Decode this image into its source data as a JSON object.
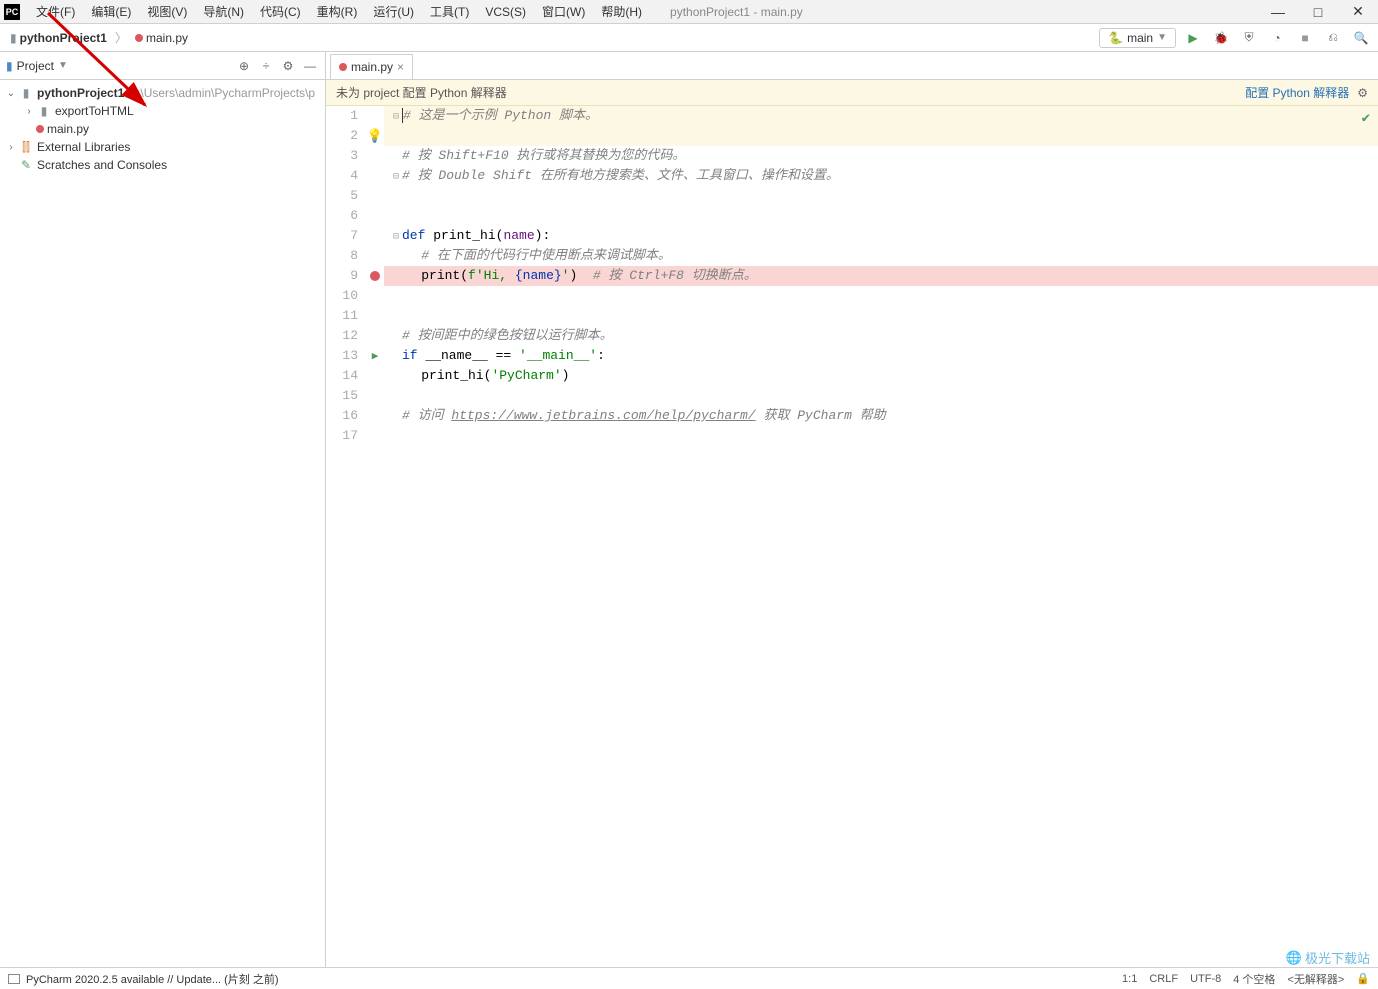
{
  "menu": {
    "items": [
      "文件(F)",
      "编辑(E)",
      "视图(V)",
      "导航(N)",
      "代码(C)",
      "重构(R)",
      "运行(U)",
      "工具(T)",
      "VCS(S)",
      "窗口(W)",
      "帮助(H)"
    ],
    "window_title": "pythonProject1 - main.py"
  },
  "breadcrumb": {
    "project": "pythonProject1",
    "file": "main.py"
  },
  "run_config": {
    "label": "main"
  },
  "sidebar": {
    "title": "Project",
    "tree": {
      "root": "pythonProject1",
      "root_path": "C:\\Users\\admin\\PycharmProjects\\p",
      "children": [
        "exportToHTML",
        "main.py"
      ],
      "external": "External Libraries",
      "scratches": "Scratches and Consoles"
    }
  },
  "tab": {
    "label": "main.py"
  },
  "warn": {
    "text": "未为 project 配置 Python 解释器",
    "link": "配置 Python 解释器"
  },
  "code": {
    "l1_cmt": "# 这是一个示例 Python 脚本。",
    "l3_cmt": "# 按 Shift+F10 执行或将其替换为您的代码。",
    "l4_cmt": "# 按 Double Shift 在所有地方搜索类、文件、工具窗口、操作和设置。",
    "l7_def": "def ",
    "l7_fn": "print_hi",
    "l7_prm": "name",
    "l8_cmt": "# 在下面的代码行中使用断点来调试脚本。",
    "l9_fn": "print",
    "l9_s1": "f'Hi, ",
    "l9_var": "{name}",
    "l9_s2": "'",
    "l9_cmt": "# 按 Ctrl+F8 切换断点。",
    "l12_cmt": "# 按间距中的绿色按钮以运行脚本。",
    "l13_if": "if ",
    "l13_name": "__name__",
    "l13_eq": " == ",
    "l13_main": "'__main__'",
    "l14_fn": "print_hi",
    "l14_arg": "'PyCharm'",
    "l16_pre": "# 访问 ",
    "l16_url": "https://www.jetbrains.com/help/pycharm/",
    "l16_post": " 获取 PyCharm 帮助"
  },
  "status": {
    "left": "PyCharm 2020.2.5 available // Update... (片刻 之前)",
    "pos": "1:1",
    "sep": "CRLF",
    "enc": "UTF-8",
    "indent": "4 个空格",
    "interp": "<无解释器>"
  },
  "watermark": "极光下载站"
}
